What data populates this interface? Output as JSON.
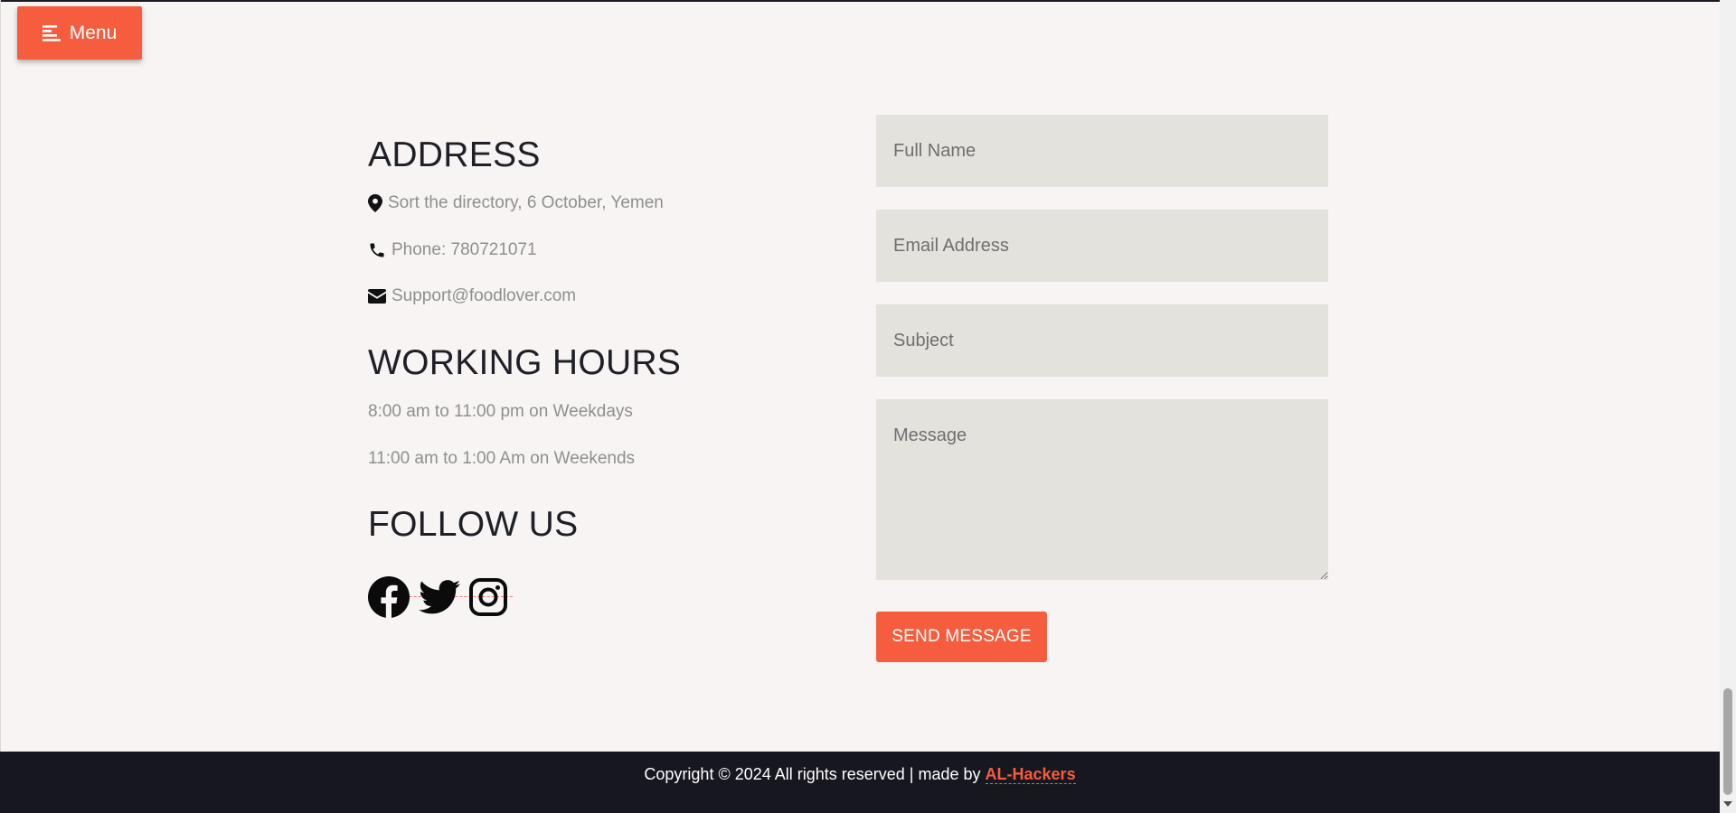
{
  "menu": {
    "label": "Menu",
    "icon": "menu-lines-icon"
  },
  "address": {
    "title": "ADDRESS",
    "location_icon": "map-pin-icon",
    "location": "Sort the directory, 6 October, Yemen",
    "phone_icon": "phone-icon",
    "phone": "Phone: 780721071",
    "email_icon": "envelope-icon",
    "email": "Support@foodlover.com"
  },
  "hours": {
    "title": "WORKING HOURS",
    "weekdays": "8:00 am to 11:00 pm on Weekdays",
    "weekends": "11:00 am to 1:00 Am on Weekends"
  },
  "follow": {
    "title": "FOLLOW US",
    "icons": [
      "facebook-icon",
      "twitter-icon",
      "instagram-icon"
    ]
  },
  "form": {
    "full_name_placeholder": "Full Name",
    "email_placeholder": "Email Address",
    "subject_placeholder": "Subject",
    "message_placeholder": "Message",
    "submit_label": "SEND MESSAGE"
  },
  "footer": {
    "text": "Copyright © 2024 All rights reserved | made by ",
    "brand": "AL-Hackers"
  },
  "colors": {
    "accent": "#f55d3e",
    "background": "#f7f4f3",
    "field": "#e3e2dd",
    "footer": "#17171f",
    "heading": "#1f1f27",
    "muted_text": "#8f8f8f"
  }
}
